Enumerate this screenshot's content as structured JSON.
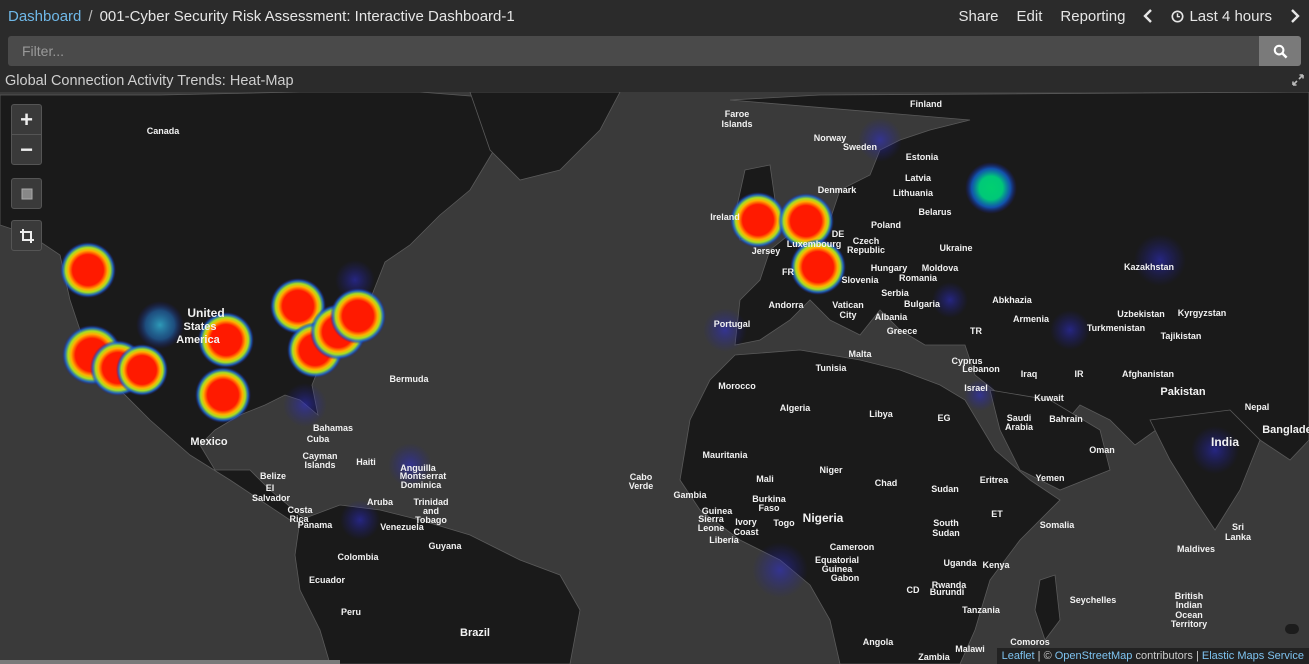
{
  "header": {
    "breadcrumb_root": "Dashboard",
    "separator": "/",
    "dashboard_title": "001-Cyber Security Risk Assessment: Interactive Dashboard-1",
    "menu": {
      "share": "Share",
      "edit": "Edit",
      "reporting": "Reporting",
      "time_range": "Last 4 hours"
    }
  },
  "filter": {
    "placeholder": "Filter..."
  },
  "panel": {
    "title": "Global Connection Activity Trends: Heat-Map"
  },
  "map": {
    "zoom_in": "+",
    "zoom_out": "−",
    "attribution": {
      "leaflet": "Leaflet",
      "sep1": " | © ",
      "osm": "OpenStreetMap",
      "contributors": " contributors | ",
      "ems": "Elastic Maps Service"
    },
    "labels": [
      {
        "text": "Canada"
      },
      {
        "text": "United"
      },
      {
        "text": "States"
      },
      {
        "text": "America"
      },
      {
        "text": "Mexico"
      },
      {
        "text": "Bermuda"
      },
      {
        "text": "Bahamas"
      },
      {
        "text": "Cuba"
      },
      {
        "text": "Cayman"
      },
      {
        "text": "Islands"
      },
      {
        "text": "Haiti"
      },
      {
        "text": "Belize"
      },
      {
        "text": "El"
      },
      {
        "text": "Salvador"
      },
      {
        "text": "Costa"
      },
      {
        "text": "Rica"
      },
      {
        "text": "Panama"
      },
      {
        "text": "Anguilla"
      },
      {
        "text": "Montserrat"
      },
      {
        "text": "Dominica"
      },
      {
        "text": "Aruba"
      },
      {
        "text": "Trinidad"
      },
      {
        "text": "and"
      },
      {
        "text": "Tobago"
      },
      {
        "text": "Venezuela"
      },
      {
        "text": "Guyana"
      },
      {
        "text": "Colombia"
      },
      {
        "text": "Ecuador"
      },
      {
        "text": "Peru"
      },
      {
        "text": "Brazil"
      },
      {
        "text": "Cabo"
      },
      {
        "text": "Verde"
      },
      {
        "text": "Faroe"
      },
      {
        "text": "Islands"
      },
      {
        "text": "Finland"
      },
      {
        "text": "Norway"
      },
      {
        "text": "Sweden"
      },
      {
        "text": "Estonia"
      },
      {
        "text": "Latvia"
      },
      {
        "text": "Lithuania"
      },
      {
        "text": "Denmark"
      },
      {
        "text": "Ireland"
      },
      {
        "text": "Jersey"
      },
      {
        "text": "DE"
      },
      {
        "text": "Luxembourg"
      },
      {
        "text": "Poland"
      },
      {
        "text": "Belarus"
      },
      {
        "text": "Czech"
      },
      {
        "text": "Republic"
      },
      {
        "text": "Ukraine"
      },
      {
        "text": "Kazakhstan"
      },
      {
        "text": "FR"
      },
      {
        "text": "Slovenia"
      },
      {
        "text": "Hungary"
      },
      {
        "text": "Moldova"
      },
      {
        "text": "Romania"
      },
      {
        "text": "Serbia"
      },
      {
        "text": "Bulgaria"
      },
      {
        "text": "Andorra"
      },
      {
        "text": "Vatican"
      },
      {
        "text": "City"
      },
      {
        "text": "Albania"
      },
      {
        "text": "Greece"
      },
      {
        "text": "Portugal"
      },
      {
        "text": "Abkhazia"
      },
      {
        "text": "Armenia"
      },
      {
        "text": "Uzbekistan"
      },
      {
        "text": "Kyrgyzstan"
      },
      {
        "text": "Turkmenistan"
      },
      {
        "text": "Tajikistan"
      },
      {
        "text": "TR"
      },
      {
        "text": "Malta"
      },
      {
        "text": "Tunisia"
      },
      {
        "text": "Cyprus"
      },
      {
        "text": "Lebanon"
      },
      {
        "text": "Israel"
      },
      {
        "text": "Iraq"
      },
      {
        "text": "IR"
      },
      {
        "text": "Afghanistan"
      },
      {
        "text": "Pakistan"
      },
      {
        "text": "Morocco"
      },
      {
        "text": "Algeria"
      },
      {
        "text": "Libya"
      },
      {
        "text": "EG"
      },
      {
        "text": "Kuwait"
      },
      {
        "text": "Saudi"
      },
      {
        "text": "Arabia"
      },
      {
        "text": "Bahrain"
      },
      {
        "text": "Nepal"
      },
      {
        "text": "Banglade"
      },
      {
        "text": "India"
      },
      {
        "text": "Mauritania"
      },
      {
        "text": "Mali"
      },
      {
        "text": "Niger"
      },
      {
        "text": "Chad"
      },
      {
        "text": "Sudan"
      },
      {
        "text": "Eritrea"
      },
      {
        "text": "Yemen"
      },
      {
        "text": "Oman"
      },
      {
        "text": "Gambia"
      },
      {
        "text": "Burkina"
      },
      {
        "text": "Faso"
      },
      {
        "text": "Guinea"
      },
      {
        "text": "Sierra"
      },
      {
        "text": "Leone"
      },
      {
        "text": "Liberia"
      },
      {
        "text": "Ivory"
      },
      {
        "text": "Coast"
      },
      {
        "text": "Togo"
      },
      {
        "text": "Nigeria"
      },
      {
        "text": "South"
      },
      {
        "text": "Sudan"
      },
      {
        "text": "ET"
      },
      {
        "text": "Somalia"
      },
      {
        "text": "Cameroon"
      },
      {
        "text": "Equatorial"
      },
      {
        "text": "Guinea"
      },
      {
        "text": "Gabon"
      },
      {
        "text": "Uganda"
      },
      {
        "text": "Kenya"
      },
      {
        "text": "Rwanda"
      },
      {
        "text": "Burundi"
      },
      {
        "text": "CD"
      },
      {
        "text": "Tanzania"
      },
      {
        "text": "Angola"
      },
      {
        "text": "Malawi"
      },
      {
        "text": "Zambia"
      },
      {
        "text": "Comoros"
      },
      {
        "text": "Seychelles"
      },
      {
        "text": "Maldives"
      },
      {
        "text": "Sri"
      },
      {
        "text": "Lanka"
      },
      {
        "text": "British"
      },
      {
        "text": "Indian"
      },
      {
        "text": "Ocean"
      },
      {
        "text": "Territory"
      }
    ]
  },
  "colors": {
    "link": "#6fb8e8",
    "heat_high": "#ff1a00",
    "heat_mid": "#ffd000",
    "heat_low": "#00c06a",
    "heat_faint": "#2a2ad0"
  }
}
